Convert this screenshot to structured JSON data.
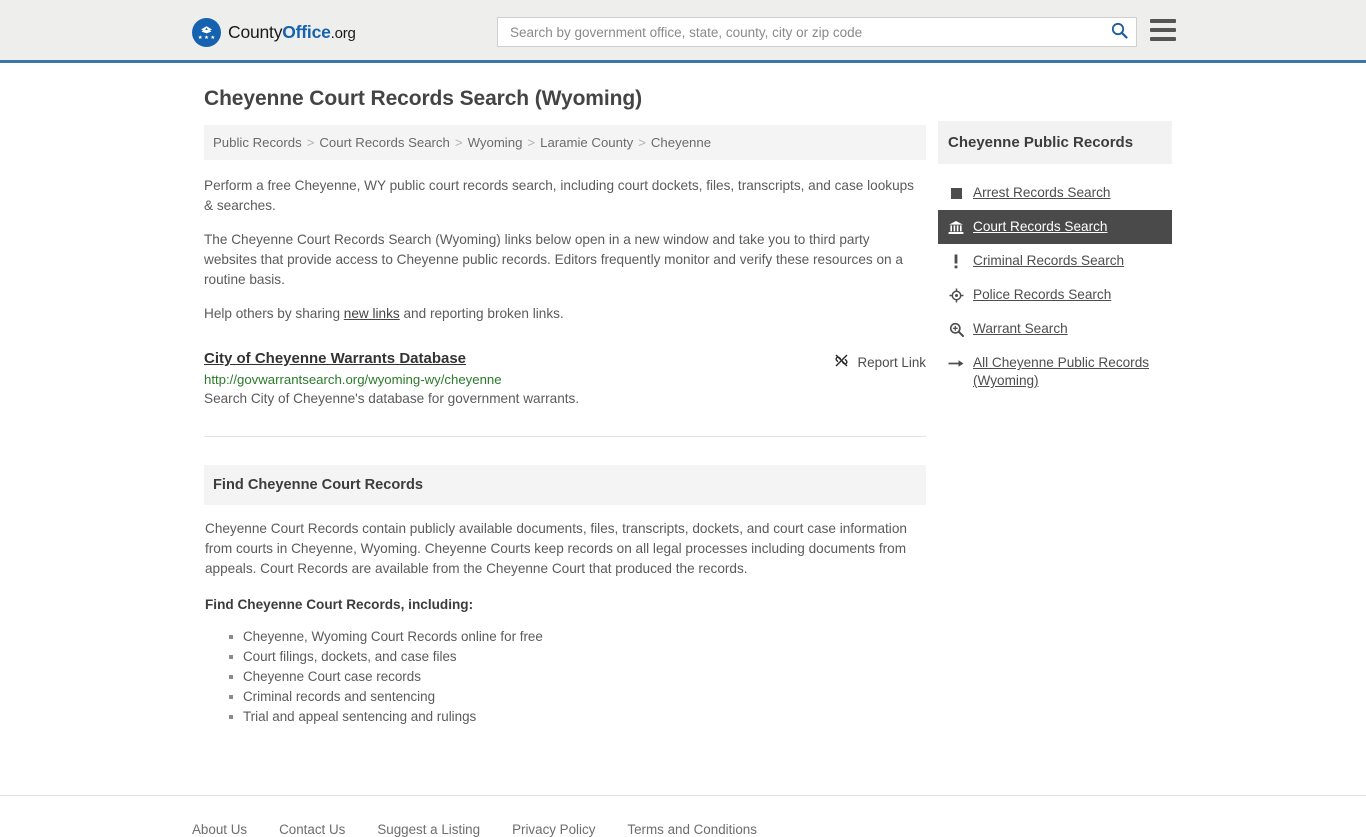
{
  "header": {
    "logo": {
      "part1": "County",
      "part2": "Office",
      "part3": ".org",
      "icon": "eagle-seal-icon"
    },
    "search": {
      "placeholder": "Search by government office, state, county, city or zip code",
      "value": "",
      "icon": "search-icon"
    },
    "menu_icon": "hamburger-menu-icon",
    "accent_color": "#3a74a8"
  },
  "main": {
    "title": "Cheyenne Court Records Search (Wyoming)",
    "breadcrumb": [
      "Public Records",
      "Court Records Search",
      "Wyoming",
      "Laramie County",
      "Cheyenne"
    ],
    "breadcrumb_separator": ">",
    "paragraphs": {
      "p1": "Perform a free Cheyenne, WY public court records search, including court dockets, files, transcripts, and case lookups & searches.",
      "p2": "The Cheyenne Court Records Search (Wyoming) links below open in a new window and take you to third party websites that provide access to Cheyenne public records. Editors frequently monitor and verify these resources on a routine basis.",
      "p3_before": "Help others by sharing ",
      "p3_link": "new links",
      "p3_after": " and reporting broken links."
    },
    "listing": {
      "title": "City of Cheyenne Warrants Database",
      "url": "http://govwarrantsearch.org/wyoming-wy/cheyenne",
      "description": "Search City of Cheyenne's database for government warrants.",
      "report_label": "Report Link",
      "report_icon": "broken-link-icon",
      "url_color": "#2a7a2a"
    },
    "section": {
      "header": "Find Cheyenne Court Records",
      "body": "Cheyenne Court Records contain publicly available documents, files, transcripts, dockets, and court case information from courts in Cheyenne, Wyoming. Cheyenne Courts keep records on all legal processes including documents from appeals. Court Records are available from the Cheyenne Court that produced the records.",
      "subhead": "Find Cheyenne Court Records, including:",
      "bullets": [
        "Cheyenne, Wyoming Court Records online for free",
        "Court filings, dockets, and case files",
        "Cheyenne Court case records",
        "Criminal records and sentencing",
        "Trial and appeal sentencing and rulings"
      ]
    }
  },
  "sidebar": {
    "title": "Cheyenne Public Records",
    "active_color": "#4a4a4a",
    "items": [
      {
        "label": "Arrest Records Search",
        "icon": "square-icon",
        "active": false
      },
      {
        "label": "Court Records Search",
        "icon": "courthouse-icon",
        "active": true
      },
      {
        "label": "Criminal Records Search",
        "icon": "exclamation-icon",
        "active": false
      },
      {
        "label": "Police Records Search",
        "icon": "police-badge-icon",
        "active": false
      },
      {
        "label": "Warrant Search",
        "icon": "magnifier-plus-icon",
        "active": false
      },
      {
        "label": "All Cheyenne Public Records (Wyoming)",
        "icon": "arrow-right-icon",
        "active": false
      }
    ]
  },
  "footer": {
    "links": [
      "About Us",
      "Contact Us",
      "Suggest a Listing",
      "Privacy Policy",
      "Terms and Conditions"
    ]
  }
}
